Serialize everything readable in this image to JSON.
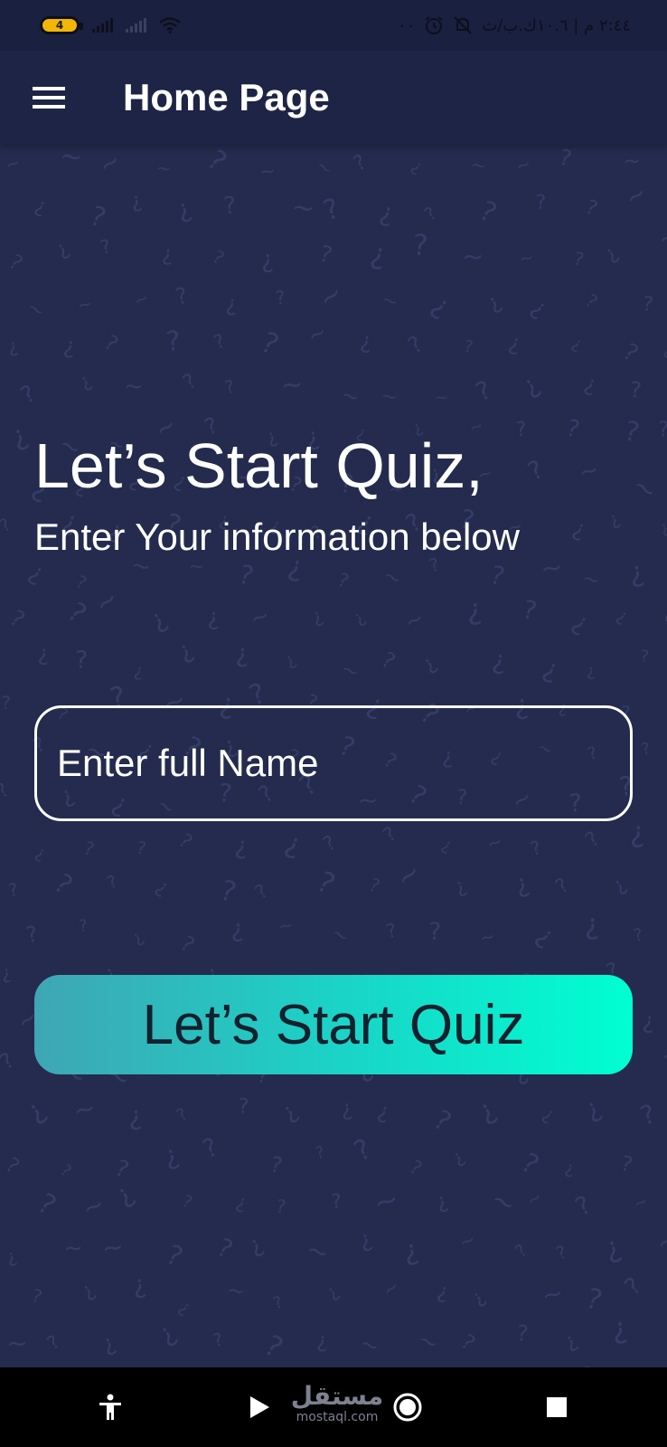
{
  "status_bar": {
    "battery_level": "4",
    "right_text": "٢:٤٤ م | ١٠.٦ك.ب/ث",
    "extra": "٠٠"
  },
  "app_bar": {
    "title": "Home Page"
  },
  "main": {
    "heading": "Let’s Start Quiz,",
    "subheading": "Enter Your information below",
    "name_input": {
      "placeholder": "Enter full Name",
      "value": ""
    },
    "start_button_label": "Let’s Start Quiz"
  },
  "watermark": {
    "top": "مستقل",
    "bottom": "mostaql.com"
  },
  "colors": {
    "background": "#242b4e",
    "app_bar": "#1e2446",
    "button_gradient_start": "#3fa6b4",
    "button_gradient_end": "#00ffd2"
  }
}
